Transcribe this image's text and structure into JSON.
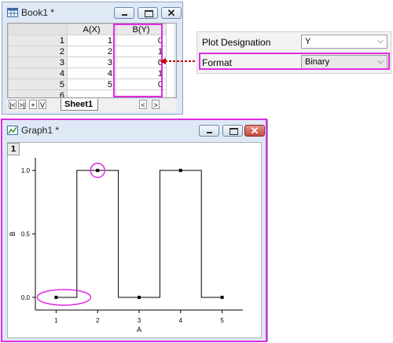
{
  "book": {
    "title": "Book1 *",
    "columns": [
      "A(X)",
      "B(Y)"
    ],
    "rows": [
      {
        "label": "1",
        "a": "1",
        "b": "0"
      },
      {
        "label": "2",
        "a": "2",
        "b": "1"
      },
      {
        "label": "3",
        "a": "3",
        "b": "0"
      },
      {
        "label": "4",
        "a": "4",
        "b": "1"
      },
      {
        "label": "5",
        "a": "5",
        "b": "0"
      },
      {
        "label": "6",
        "a": "",
        "b": ""
      }
    ],
    "nav": [
      "|<",
      ">|",
      "+",
      "V"
    ],
    "sheet_tab": "Sheet1",
    "scroll_left": "<",
    "scroll_right": ">"
  },
  "properties": {
    "rows": [
      {
        "label": "Plot Designation",
        "value": "Y"
      },
      {
        "label": "Format",
        "value": "Binary"
      }
    ]
  },
  "graph": {
    "title": "Graph1 *",
    "layer": "1",
    "chart_data": {
      "type": "line",
      "style": "step",
      "x": [
        1,
        2,
        3,
        4,
        5
      ],
      "y": [
        0,
        1,
        0,
        1,
        0
      ],
      "xlabel": "A",
      "ylabel": "B",
      "xticks": [
        "1",
        "2",
        "3",
        "4",
        "5"
      ],
      "yticks": [
        "0.0",
        "0.5",
        "1.0"
      ],
      "xlim": [
        0.5,
        5.5
      ],
      "ylim": [
        -0.1,
        1.1
      ],
      "highlight_points": [
        {
          "x": 1,
          "y": 0
        },
        {
          "x": 2,
          "y": 1
        }
      ]
    }
  },
  "colors": {
    "highlight": "#e02ce0",
    "arrow": "#c00000",
    "line": "#000000"
  }
}
